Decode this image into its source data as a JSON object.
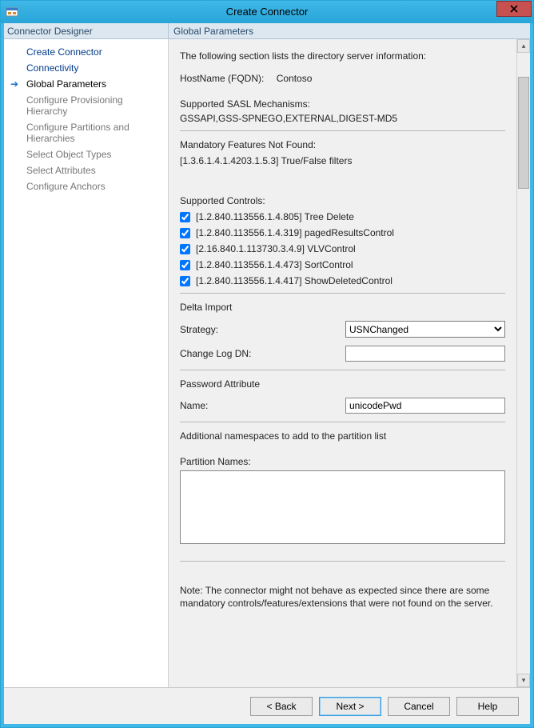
{
  "window": {
    "title": "Create Connector"
  },
  "sidebar": {
    "header": "Connector Designer",
    "items": [
      {
        "label": "Create Connector",
        "state": "done"
      },
      {
        "label": "Connectivity",
        "state": "done"
      },
      {
        "label": "Global Parameters",
        "state": "current"
      },
      {
        "label": "Configure Provisioning Hierarchy",
        "state": "future"
      },
      {
        "label": "Configure Partitions and Hierarchies",
        "state": "future"
      },
      {
        "label": "Select Object Types",
        "state": "future"
      },
      {
        "label": "Select Attributes",
        "state": "future"
      },
      {
        "label": "Configure Anchors",
        "state": "future"
      }
    ]
  },
  "content": {
    "header": "Global Parameters",
    "intro": "The following section lists the directory server information:",
    "hostnameLabel": "HostName (FQDN):",
    "hostnameValue": "Contoso",
    "saslLabel": "Supported SASL Mechanisms:",
    "saslValue": "GSSAPI,GSS-SPNEGO,EXTERNAL,DIGEST-MD5",
    "mandatoryHeader": "Mandatory Features Not Found:",
    "mandatoryItem": "[1.3.6.1.4.1.4203.1.5.3] True/False filters",
    "controlsHeader": "Supported Controls:",
    "controls": [
      {
        "label": "[1.2.840.113556.1.4.805] Tree Delete",
        "checked": true
      },
      {
        "label": "[1.2.840.113556.1.4.319] pagedResultsControl",
        "checked": true
      },
      {
        "label": "[2.16.840.1.113730.3.4.9] VLVControl",
        "checked": true
      },
      {
        "label": "[1.2.840.113556.1.4.473] SortControl",
        "checked": true
      },
      {
        "label": "[1.2.840.113556.1.4.417] ShowDeletedControl",
        "checked": true
      }
    ],
    "deltaHeader": "Delta Import",
    "strategyLabel": "Strategy:",
    "strategyValue": "USNChanged",
    "changelogLabel": "Change Log DN:",
    "changelogValue": "",
    "pwdHeader": "Password Attribute",
    "pwdNameLabel": "Name:",
    "pwdNameValue": "unicodePwd",
    "nsHeader": "Additional namespaces to add to the partition list",
    "partitionLabel": "Partition Names:",
    "partitionValue": "",
    "note": "Note: The connector might not behave as expected since there are some mandatory controls/features/extensions that were not found on the server."
  },
  "footer": {
    "back": "<  Back",
    "next": "Next  >",
    "cancel": "Cancel",
    "help": "Help"
  }
}
